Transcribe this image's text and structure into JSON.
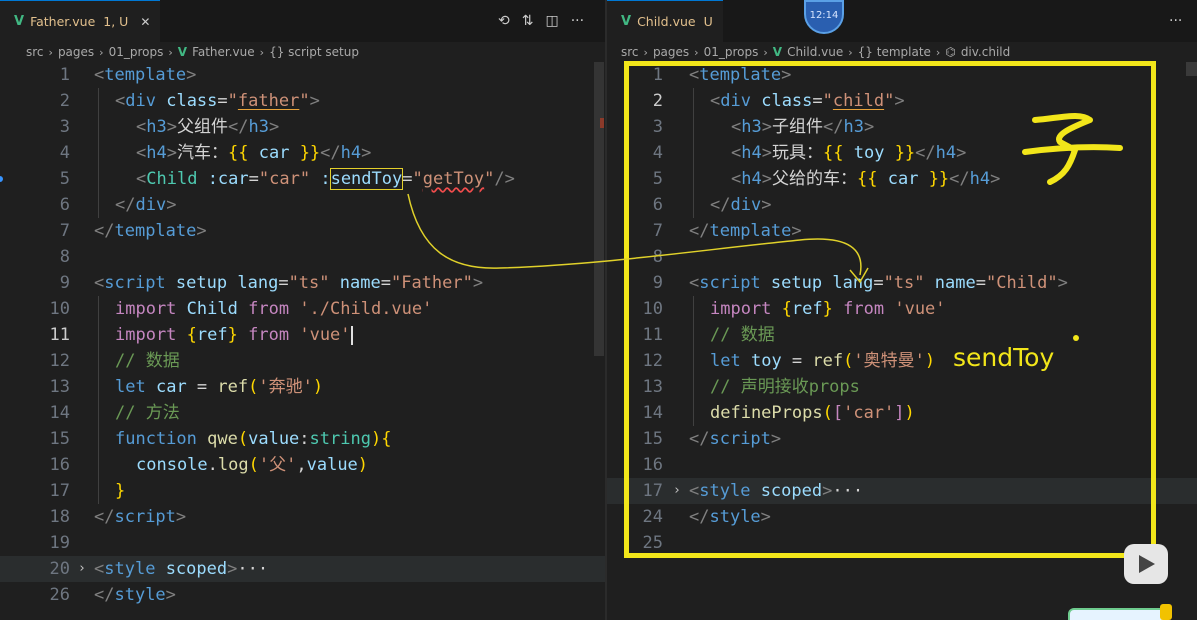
{
  "left": {
    "tab": {
      "icon": "V",
      "title": "Father.vue",
      "badge": "1, U",
      "close": "✕"
    },
    "actions": [
      "history-icon",
      "compare-changes-icon",
      "split-editor-icon",
      "more-actions-icon"
    ],
    "breadcrumb": [
      "src",
      "pages",
      "01_props",
      "Father.vue",
      "{} script setup"
    ],
    "lines": [
      {
        "n": "1",
        "tokens": [
          [
            "t",
            "<"
          ],
          [
            "tg",
            "template"
          ],
          [
            "t",
            ">"
          ]
        ]
      },
      {
        "n": "2",
        "indent": 1,
        "tokens": [
          [
            "t",
            "<"
          ],
          [
            "tg",
            "div"
          ],
          [
            "tx",
            " "
          ],
          [
            "at",
            "class"
          ],
          [
            "tx",
            "="
          ],
          [
            "st",
            "\""
          ],
          [
            "st sq",
            "father"
          ],
          [
            "st",
            "\""
          ],
          [
            "t",
            ">"
          ]
        ]
      },
      {
        "n": "3",
        "indent": 2,
        "tokens": [
          [
            "t",
            "<"
          ],
          [
            "tg",
            "h3"
          ],
          [
            "t",
            ">"
          ],
          [
            "tx",
            "父组件"
          ],
          [
            "t",
            "</"
          ],
          [
            "tg",
            "h3"
          ],
          [
            "t",
            ">"
          ]
        ]
      },
      {
        "n": "4",
        "indent": 2,
        "tokens": [
          [
            "t",
            "<"
          ],
          [
            "tg",
            "h4"
          ],
          [
            "t",
            ">"
          ],
          [
            "tx",
            "汽车："
          ],
          [
            "br",
            "{{"
          ],
          [
            "tx",
            " "
          ],
          [
            "at",
            "car"
          ],
          [
            "tx",
            " "
          ],
          [
            "br",
            "}}"
          ],
          [
            "t",
            "</"
          ],
          [
            "tg",
            "h4"
          ],
          [
            "t",
            ">"
          ]
        ]
      },
      {
        "n": "5",
        "indent": 2,
        "tokens": [
          [
            "t",
            "<"
          ],
          [
            "cls",
            "Child"
          ],
          [
            "tx",
            " "
          ],
          [
            "at",
            ":car"
          ],
          [
            "tx",
            "="
          ],
          [
            "st",
            "\"car\""
          ],
          [
            "tx",
            " "
          ],
          [
            "at",
            ":"
          ],
          [
            "at sendbox",
            "sendToy"
          ],
          [
            "tx",
            "="
          ],
          [
            "st",
            "\""
          ],
          [
            "st wavy",
            "getToy"
          ],
          [
            "st",
            "\""
          ],
          [
            "t",
            "/>"
          ]
        ]
      },
      {
        "n": "6",
        "indent": 1,
        "tokens": [
          [
            "t",
            "</"
          ],
          [
            "tg",
            "div"
          ],
          [
            "t",
            ">"
          ]
        ]
      },
      {
        "n": "7",
        "tokens": [
          [
            "t",
            "</"
          ],
          [
            "tg",
            "template"
          ],
          [
            "t",
            ">"
          ]
        ]
      },
      {
        "n": "8",
        "tokens": []
      },
      {
        "n": "9",
        "tokens": [
          [
            "t",
            "<"
          ],
          [
            "tg",
            "script"
          ],
          [
            "tx",
            " "
          ],
          [
            "at",
            "setup"
          ],
          [
            "tx",
            " "
          ],
          [
            "at",
            "lang"
          ],
          [
            "tx",
            "="
          ],
          [
            "st",
            "\"ts\""
          ],
          [
            "tx",
            " "
          ],
          [
            "at",
            "name"
          ],
          [
            "tx",
            "="
          ],
          [
            "st",
            "\"Father\""
          ],
          [
            "t",
            ">"
          ]
        ]
      },
      {
        "n": "10",
        "indent": 1,
        "tokens": [
          [
            "kw",
            "import"
          ],
          [
            "tx",
            " "
          ],
          [
            "at",
            "Child"
          ],
          [
            "tx",
            " "
          ],
          [
            "kw",
            "from"
          ],
          [
            "tx",
            " "
          ],
          [
            "st",
            "'./Child.vue'"
          ]
        ]
      },
      {
        "n": "11",
        "indent": 1,
        "current": true,
        "cursor": true,
        "tokens": [
          [
            "kw",
            "import"
          ],
          [
            "tx",
            " "
          ],
          [
            "br",
            "{"
          ],
          [
            "at",
            "ref"
          ],
          [
            "br",
            "}"
          ],
          [
            "tx",
            " "
          ],
          [
            "kw",
            "from"
          ],
          [
            "tx",
            " "
          ],
          [
            "st",
            "'vue'"
          ]
        ]
      },
      {
        "n": "12",
        "indent": 1,
        "tokens": [
          [
            "cm",
            "// 数据"
          ]
        ]
      },
      {
        "n": "13",
        "indent": 1,
        "tokens": [
          [
            "kb",
            "let"
          ],
          [
            "tx",
            " "
          ],
          [
            "at",
            "car"
          ],
          [
            "tx",
            " = "
          ],
          [
            "fn",
            "ref"
          ],
          [
            "br",
            "("
          ],
          [
            "st",
            "'奔驰'"
          ],
          [
            "br",
            ")"
          ]
        ]
      },
      {
        "n": "14",
        "indent": 1,
        "tokens": [
          [
            "cm",
            "// 方法"
          ]
        ]
      },
      {
        "n": "15",
        "indent": 1,
        "tokens": [
          [
            "kb",
            "function"
          ],
          [
            "tx",
            " "
          ],
          [
            "fn",
            "qwe"
          ],
          [
            "br",
            "("
          ],
          [
            "at",
            "value"
          ],
          [
            "tx",
            ":"
          ],
          [
            "cls",
            "string"
          ],
          [
            "br",
            ")"
          ],
          [
            "br",
            "{"
          ]
        ]
      },
      {
        "n": "16",
        "indent": 2,
        "tokens": [
          [
            "at",
            "console"
          ],
          [
            "tx",
            "."
          ],
          [
            "fn",
            "log"
          ],
          [
            "br",
            "("
          ],
          [
            "st",
            "'父'"
          ],
          [
            "tx",
            ","
          ],
          [
            "at",
            "value"
          ],
          [
            "br",
            ")"
          ]
        ]
      },
      {
        "n": "17",
        "indent": 1,
        "tokens": [
          [
            "br",
            "}"
          ]
        ]
      },
      {
        "n": "18",
        "tokens": [
          [
            "t",
            "</"
          ],
          [
            "tg",
            "script"
          ],
          [
            "t",
            ">"
          ]
        ]
      },
      {
        "n": "19",
        "tokens": []
      },
      {
        "n": "20",
        "fold": true,
        "highlight": true,
        "tokens": [
          [
            "t",
            "<"
          ],
          [
            "tg",
            "style"
          ],
          [
            "tx",
            " "
          ],
          [
            "at",
            "scoped"
          ],
          [
            "t",
            ">"
          ],
          [
            "tx",
            "···"
          ]
        ]
      },
      {
        "n": "26",
        "tokens": [
          [
            "t",
            "</"
          ],
          [
            "tg",
            "style"
          ],
          [
            "t",
            ">"
          ]
        ]
      }
    ]
  },
  "right": {
    "tab": {
      "icon": "V",
      "title": "Child.vue",
      "badge": "U",
      "close": ""
    },
    "actions": [
      "more-actions-icon"
    ],
    "breadcrumb": [
      "src",
      "pages",
      "01_props",
      "Child.vue",
      "{} template",
      "div.child"
    ],
    "lines": [
      {
        "n": "1",
        "tokens": [
          [
            "t",
            "<"
          ],
          [
            "tg",
            "template"
          ],
          [
            "t",
            ">"
          ]
        ]
      },
      {
        "n": "2",
        "indent": 1,
        "current": true,
        "tokens": [
          [
            "t",
            "<"
          ],
          [
            "tg",
            "div"
          ],
          [
            "tx",
            " "
          ],
          [
            "at",
            "class"
          ],
          [
            "tx",
            "="
          ],
          [
            "st",
            "\""
          ],
          [
            "st sq",
            "child"
          ],
          [
            "st",
            "\""
          ],
          [
            "t",
            ">"
          ]
        ]
      },
      {
        "n": "3",
        "indent": 2,
        "tokens": [
          [
            "t",
            "<"
          ],
          [
            "tg",
            "h3"
          ],
          [
            "t",
            ">"
          ],
          [
            "tx",
            "子组件"
          ],
          [
            "t",
            "</"
          ],
          [
            "tg",
            "h3"
          ],
          [
            "t",
            ">"
          ]
        ]
      },
      {
        "n": "4",
        "indent": 2,
        "tokens": [
          [
            "t",
            "<"
          ],
          [
            "tg",
            "h4"
          ],
          [
            "t",
            ">"
          ],
          [
            "tx",
            "玩具："
          ],
          [
            "br",
            "{{"
          ],
          [
            "tx",
            " "
          ],
          [
            "at",
            "toy"
          ],
          [
            "tx",
            " "
          ],
          [
            "br",
            "}}"
          ],
          [
            "t",
            "</"
          ],
          [
            "tg",
            "h4"
          ],
          [
            "t",
            ">"
          ]
        ]
      },
      {
        "n": "5",
        "indent": 2,
        "tokens": [
          [
            "t",
            "<"
          ],
          [
            "tg",
            "h4"
          ],
          [
            "t",
            ">"
          ],
          [
            "tx",
            "父给的车："
          ],
          [
            "br",
            "{{"
          ],
          [
            "tx",
            " "
          ],
          [
            "at",
            "car"
          ],
          [
            "tx",
            " "
          ],
          [
            "br",
            "}}"
          ],
          [
            "t",
            "</"
          ],
          [
            "tg",
            "h4"
          ],
          [
            "t",
            ">"
          ]
        ]
      },
      {
        "n": "6",
        "indent": 1,
        "tokens": [
          [
            "t",
            "</"
          ],
          [
            "tg",
            "div"
          ],
          [
            "t",
            ">"
          ]
        ]
      },
      {
        "n": "7",
        "tokens": [
          [
            "t",
            "</"
          ],
          [
            "tg",
            "template"
          ],
          [
            "t",
            ">"
          ]
        ]
      },
      {
        "n": "8",
        "tokens": []
      },
      {
        "n": "9",
        "tokens": [
          [
            "t",
            "<"
          ],
          [
            "tg",
            "script"
          ],
          [
            "tx",
            " "
          ],
          [
            "at",
            "setup"
          ],
          [
            "tx",
            " "
          ],
          [
            "at",
            "lang"
          ],
          [
            "tx",
            "="
          ],
          [
            "st",
            "\"ts\""
          ],
          [
            "tx",
            " "
          ],
          [
            "at",
            "name"
          ],
          [
            "tx",
            "="
          ],
          [
            "st",
            "\"Child\""
          ],
          [
            "t",
            ">"
          ]
        ]
      },
      {
        "n": "10",
        "indent": 1,
        "tokens": [
          [
            "kw",
            "import"
          ],
          [
            "tx",
            " "
          ],
          [
            "br",
            "{"
          ],
          [
            "at",
            "ref"
          ],
          [
            "br",
            "}"
          ],
          [
            "tx",
            " "
          ],
          [
            "kw",
            "from"
          ],
          [
            "tx",
            " "
          ],
          [
            "st",
            "'vue'"
          ]
        ]
      },
      {
        "n": "11",
        "indent": 1,
        "tokens": [
          [
            "cm",
            "// 数据"
          ]
        ]
      },
      {
        "n": "12",
        "indent": 1,
        "tokens": [
          [
            "kb",
            "let"
          ],
          [
            "tx",
            " "
          ],
          [
            "at",
            "toy"
          ],
          [
            "tx",
            " = "
          ],
          [
            "fn",
            "ref"
          ],
          [
            "br",
            "("
          ],
          [
            "st",
            "'奥特曼'"
          ],
          [
            "br",
            ")"
          ]
        ]
      },
      {
        "n": "13",
        "indent": 1,
        "tokens": [
          [
            "cm",
            "// 声明接收props"
          ]
        ]
      },
      {
        "n": "14",
        "indent": 1,
        "tokens": [
          [
            "fn",
            "defineProps"
          ],
          [
            "br",
            "("
          ],
          [
            "kw",
            "["
          ],
          [
            "st",
            "'car'"
          ],
          [
            "kw",
            "]"
          ],
          [
            "br",
            ")"
          ]
        ]
      },
      {
        "n": "15",
        "tokens": [
          [
            "t",
            "</"
          ],
          [
            "tg",
            "script"
          ],
          [
            "t",
            ">"
          ]
        ]
      },
      {
        "n": "16",
        "tokens": []
      },
      {
        "n": "17",
        "fold": true,
        "highlight": true,
        "tokens": [
          [
            "t",
            "<"
          ],
          [
            "tg",
            "style"
          ],
          [
            "tx",
            " "
          ],
          [
            "at",
            "scoped"
          ],
          [
            "t",
            ">"
          ],
          [
            "tx",
            "···"
          ]
        ]
      },
      {
        "n": "24",
        "tokens": [
          [
            "t",
            "</"
          ],
          [
            "tg",
            "style"
          ],
          [
            "t",
            ">"
          ]
        ]
      },
      {
        "n": "25",
        "tokens": []
      }
    ]
  },
  "overlay": {
    "clock": "12:14",
    "annotation_text": "sendToy",
    "colors": {
      "annotation": "#f2e61a",
      "vue": "#41b883",
      "accent": "#0078d4"
    }
  }
}
